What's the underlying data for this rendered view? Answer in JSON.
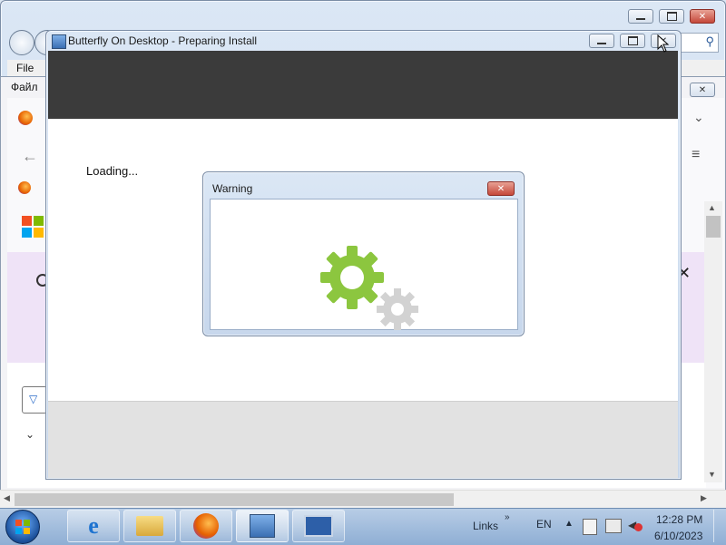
{
  "background_browser": {
    "menu_file": "File",
    "menu_file_ru": "Файл"
  },
  "installer": {
    "title": "Butterfly On Desktop - Preparing Install",
    "loading": "Loading..."
  },
  "warning_dialog": {
    "title": "Warning"
  },
  "taskbar": {
    "links": "Links",
    "language": "EN",
    "time": "12:28 PM",
    "date": "6/10/2023",
    "items": [
      {
        "name": "internet-explorer",
        "icon": "ie-icon"
      },
      {
        "name": "file-explorer",
        "icon": "folder-icon"
      },
      {
        "name": "firefox",
        "icon": "firefox-icon"
      },
      {
        "name": "installer",
        "icon": "installer-icon"
      },
      {
        "name": "remote-desktop",
        "icon": "monitor-keyboard-icon"
      }
    ]
  },
  "colors": {
    "gear_green": "#8cc63f",
    "gear_gray": "#cfcfcf",
    "installer_header": "#3b3b3b",
    "close_red": "#c5483a"
  }
}
